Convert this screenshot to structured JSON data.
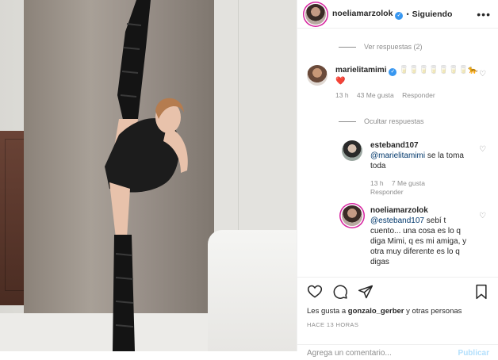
{
  "post_header": {
    "username": "noeliamarzolok",
    "follow_status": "Siguiendo",
    "more_label": "•••"
  },
  "comments": {
    "view_replies": "Ver respuestas (2)",
    "hide_replies": "Ocultar respuestas",
    "items": [
      {
        "username": "marielitamimi",
        "text": "🥛🥛🥛🥛🥛🥛🥛🐆❤️",
        "time": "13 h",
        "likes": "43 Me gusta",
        "reply": "Responder"
      },
      {
        "username": "esteband107",
        "mention": "@marielitamimi",
        "text": " se la toma toda",
        "time": "13 h",
        "likes": "7 Me gusta",
        "reply": "Responder"
      },
      {
        "username": "noeliamarzolok",
        "mention": "@esteband107",
        "text": " sebí t cuento... una cosa es lo q diga Mimi, q es mi amiga, y otra muy diferente es lo q digas"
      }
    ]
  },
  "actions": {
    "likes_prefix": "Les gusta a ",
    "likes_user": "gonzalo_gerber",
    "likes_suffix": " y otras personas",
    "timestamp": "HACE 13 HORAS",
    "comment_placeholder": "Agrega un comentario...",
    "publish_label": "Publicar"
  },
  "colors": {
    "accent_blue": "#3897f0",
    "heart_red": "#ed4956",
    "muted": "#8e8e8e"
  }
}
